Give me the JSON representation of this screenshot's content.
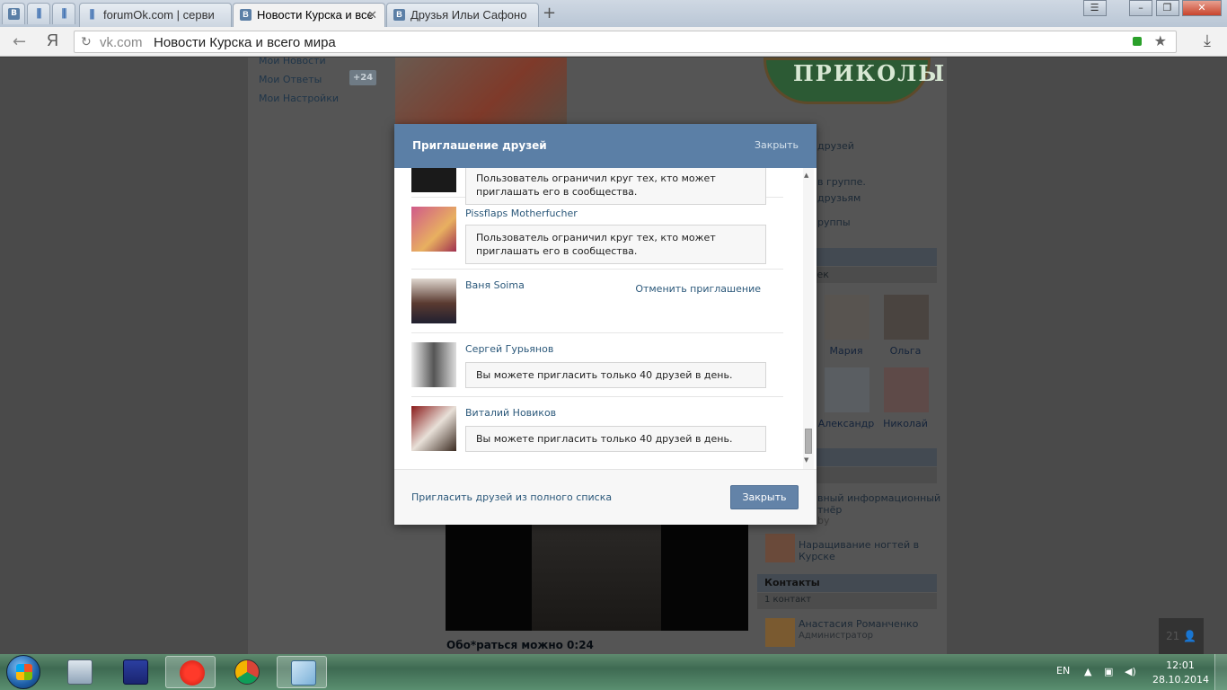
{
  "browser": {
    "tabs": [
      {
        "label": "forumOk.com | серви"
      },
      {
        "label": "Новости Курска и все"
      },
      {
        "label": "Друзья Ильи Сафоно"
      }
    ],
    "pinned_tab_icon": "В",
    "new_tab_icon": "+",
    "address": {
      "domain": "vk.com",
      "title": "Новости Курска и всего мира"
    },
    "yandex_glyph": "Я"
  },
  "page": {
    "left_menu": [
      "Мои Новости",
      "Мои Ответы",
      "Мои Настройки"
    ],
    "answers_badge": "+24",
    "logo_text": "ПРИКОЛЫ",
    "right_texts": {
      "friends": "друзей",
      "in_group": "в группе.",
      "to_friends": "друзьям",
      "groups": "руппы",
      "people": "век"
    },
    "friends": [
      {
        "name": "Мария"
      },
      {
        "name": "Ольга"
      },
      {
        "name": "Александр"
      },
      {
        "name": "Николай"
      }
    ],
    "links": [
      {
        "text": "вный информационный"
      },
      {
        "text": "тнёр"
      },
      {
        "text": "by"
      },
      {
        "text": "Наращивание ногтей в Курске"
      }
    ],
    "contacts_title": "Контакты",
    "contacts_count": "1 контакт",
    "contact": {
      "name": "Анастасия Романченко",
      "role": "Администратор"
    },
    "video_caption": "Обо*раться можно",
    "video_time": "0:24",
    "notif_count": "21"
  },
  "modal": {
    "title": "Приглашение друзей",
    "close_link": "Закрыть",
    "rows": [
      {
        "name": "",
        "msg": "Пользователь ограничил круг тех, кто может приглашать его в сообщества."
      },
      {
        "name": "Pissflaps Motherfucher",
        "msg": "Пользователь ограничил круг тех, кто может приглашать его в сообщества."
      },
      {
        "name": "Ваня Soima",
        "action": "Отменить приглашение"
      },
      {
        "name": "Сергей Гурьянов",
        "msg": "Вы можете пригласить только 40 друзей в день."
      },
      {
        "name": "Виталий Новиков",
        "msg": "Вы можете пригласить только 40 друзей в день."
      }
    ],
    "footer_link": "Пригласить друзей из полного списка",
    "footer_button": "Закрыть"
  },
  "taskbar": {
    "lang": "EN",
    "time": "12:01",
    "date": "28.10.2014"
  },
  "colors": {
    "vk_blue": "#5b7fa6",
    "link": "#2b587a"
  }
}
